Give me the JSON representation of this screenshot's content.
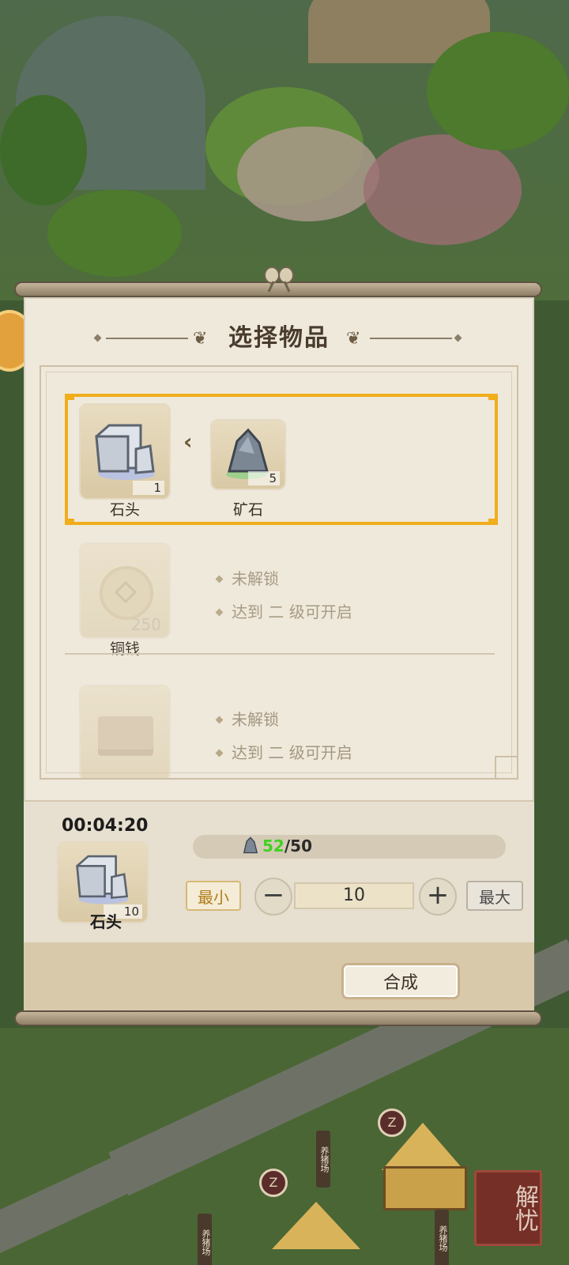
{
  "dialog": {
    "title": "选择物品"
  },
  "recipes": [
    {
      "state": "selected",
      "output": {
        "name": "石头",
        "count": "1",
        "icon": "stone-block-icon"
      },
      "input": {
        "name": "矿石",
        "count": "5",
        "icon": "ore-icon"
      }
    },
    {
      "state": "locked",
      "output": {
        "name": "铜钱",
        "count": "250",
        "icon": "copper-coin-icon"
      },
      "lines": [
        "未解锁",
        "达到 二 级可开启"
      ]
    },
    {
      "state": "locked",
      "output": {
        "name": "",
        "count": "",
        "icon": "brick-icon"
      },
      "lines": [
        "未解锁",
        "达到 二 级可开启"
      ]
    }
  ],
  "craft": {
    "timer": "00:04:20",
    "output_name": "石头",
    "output_count": "10",
    "ore_have": "52",
    "ore_need": "/50",
    "min_label": "最小",
    "max_label": "最大",
    "minus_label": "−",
    "plus_label": "+",
    "quantity": "10",
    "synthesize_label": "合成"
  },
  "map": {
    "sign_labels": [
      "养猪场",
      "养猪场",
      "养猪场"
    ],
    "seal_text": "解忧"
  },
  "colors": {
    "selection": "#f0ad1c",
    "have_count": "#3fd21f",
    "panel": "#efe9dc"
  }
}
